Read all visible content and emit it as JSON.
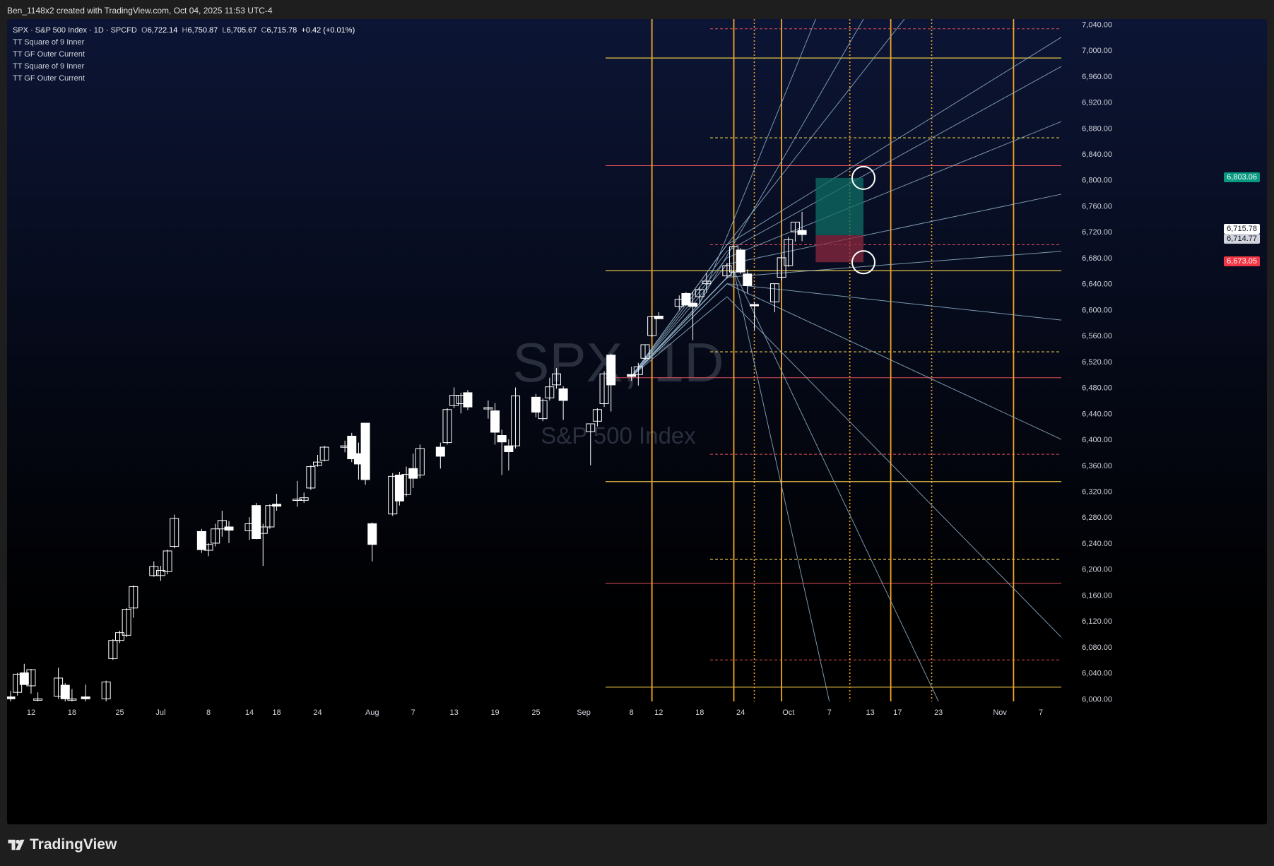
{
  "header": {
    "text": "Ben_1148x2 created with TradingView.com, Oct 04, 2025 11:53 UTC-4"
  },
  "brand": {
    "text": "TradingView",
    "icon": "tradingview-logo-icon"
  },
  "legend": {
    "symbol": "SPX · S&P 500 Index · 1D · SPCFD",
    "open_label": "O",
    "open": "6,722.14",
    "high_label": "H",
    "high": "6,750.87",
    "low_label": "L",
    "low": "6,705.67",
    "close_label": "C",
    "close": "6,715.78",
    "change": "+0.42 (+0.01%)",
    "indicators": [
      "TT Square of 9 Inner",
      "TT GF Outer Current",
      "TT Square of 9 Inner",
      "TT GF Outer Current"
    ]
  },
  "watermark": {
    "symbol": "SPX, 1D",
    "name": "S&P 500 Index"
  },
  "colors": {
    "background_top": "#0c1535",
    "background_bottom": "#000000",
    "candle": "#ffffff",
    "orange": "#f5a623",
    "yellow": "#e8c547",
    "red": "#e0505a",
    "fan": "#8fb0c8",
    "target_zone": "#0d6e66",
    "stop_zone": "#8b2840",
    "tag_green": "#089981",
    "tag_red": "#f23645"
  },
  "chart_data": {
    "type": "candlestick",
    "y_axis": {
      "range": [
        5996,
        7048
      ],
      "ticks": [
        6000,
        6040,
        6080,
        6120,
        6160,
        6200,
        6240,
        6280,
        6320,
        6360,
        6400,
        6440,
        6480,
        6520,
        6560,
        6600,
        6640,
        6680,
        6720,
        6760,
        6800,
        6840,
        6880,
        6920,
        6960,
        7000,
        7040
      ],
      "tick_labels": [
        "6,000.00",
        "6,040.00",
        "6,080.00",
        "6,120.00",
        "6,160.00",
        "6,200.00",
        "6,240.00",
        "6,280.00",
        "6,320.00",
        "6,360.00",
        "6,400.00",
        "6,440.00",
        "6,480.00",
        "6,520.00",
        "6,560.00",
        "6,600.00",
        "6,640.00",
        "6,680.00",
        "6,720.00",
        "6,760.00",
        "6,800.00",
        "6,840.00",
        "6,880.00",
        "6,920.00",
        "6,960.00",
        "7,000.00",
        "7,040.00"
      ]
    },
    "x_axis": {
      "start_date": "2025-06-09",
      "end_date": "2025-11-10",
      "labels": [
        {
          "date": "2025-06-12",
          "text": "12"
        },
        {
          "date": "2025-06-18",
          "text": "18"
        },
        {
          "date": "2025-06-25",
          "text": "25"
        },
        {
          "date": "2025-07-01",
          "text": "Jul"
        },
        {
          "date": "2025-07-08",
          "text": "8"
        },
        {
          "date": "2025-07-14",
          "text": "14"
        },
        {
          "date": "2025-07-18",
          "text": "18"
        },
        {
          "date": "2025-07-24",
          "text": "24"
        },
        {
          "date": "2025-08-01",
          "text": "Aug"
        },
        {
          "date": "2025-08-07",
          "text": "7"
        },
        {
          "date": "2025-08-13",
          "text": "13"
        },
        {
          "date": "2025-08-19",
          "text": "19"
        },
        {
          "date": "2025-08-25",
          "text": "25"
        },
        {
          "date": "2025-09-01",
          "text": "Sep"
        },
        {
          "date": "2025-09-08",
          "text": "8"
        },
        {
          "date": "2025-09-12",
          "text": "12"
        },
        {
          "date": "2025-09-18",
          "text": "18"
        },
        {
          "date": "2025-09-24",
          "text": "24"
        },
        {
          "date": "2025-10-01",
          "text": "Oct"
        },
        {
          "date": "2025-10-07",
          "text": "7"
        },
        {
          "date": "2025-10-13",
          "text": "13"
        },
        {
          "date": "2025-10-17",
          "text": "17"
        },
        {
          "date": "2025-10-23",
          "text": "23"
        },
        {
          "date": "2025-11-01",
          "text": "Nov"
        },
        {
          "date": "2025-11-07",
          "text": "7"
        }
      ]
    },
    "candles": [
      {
        "d": "2025-06-09",
        "o": 6003,
        "h": 6012,
        "l": 5996,
        "c": 6000
      },
      {
        "d": "2025-06-10",
        "o": 6010,
        "h": 6040,
        "l": 6005,
        "c": 6038
      },
      {
        "d": "2025-06-11",
        "o": 6040,
        "h": 6054,
        "l": 6022,
        "c": 6022
      },
      {
        "d": "2025-06-12",
        "o": 6020,
        "h": 6046,
        "l": 6008,
        "c": 6045
      },
      {
        "d": "2025-06-13",
        "o": 6000,
        "h": 6010,
        "l": 5996,
        "c": 6000
      },
      {
        "d": "2025-06-16",
        "o": 6004,
        "h": 6048,
        "l": 6000,
        "c": 6032
      },
      {
        "d": "2025-06-17",
        "o": 6021,
        "h": 6024,
        "l": 5996,
        "c": 6000
      },
      {
        "d": "2025-06-18",
        "o": 6000,
        "h": 6015,
        "l": 5996,
        "c": 6000
      },
      {
        "d": "2025-06-20",
        "o": 6003,
        "h": 6022,
        "l": 5996,
        "c": 6000
      },
      {
        "d": "2025-06-23",
        "o": 6000,
        "h": 6028,
        "l": 5996,
        "c": 6026
      },
      {
        "d": "2025-06-24",
        "o": 6062,
        "h": 6092,
        "l": 6060,
        "c": 6090
      },
      {
        "d": "2025-06-25",
        "o": 6090,
        "h": 6105,
        "l": 6086,
        "c": 6102
      },
      {
        "d": "2025-06-26",
        "o": 6098,
        "h": 6140,
        "l": 6095,
        "c": 6138
      },
      {
        "d": "2025-06-27",
        "o": 6140,
        "h": 6175,
        "l": 6125,
        "c": 6173
      },
      {
        "d": "2025-06-30",
        "o": 6190,
        "h": 6212,
        "l": 6188,
        "c": 6204
      },
      {
        "d": "2025-07-01",
        "o": 6190,
        "h": 6205,
        "l": 6182,
        "c": 6198
      },
      {
        "d": "2025-07-02",
        "o": 6196,
        "h": 6230,
        "l": 6192,
        "c": 6228
      },
      {
        "d": "2025-07-03",
        "o": 6235,
        "h": 6284,
        "l": 6232,
        "c": 6278
      },
      {
        "d": "2025-07-07",
        "o": 6258,
        "h": 6262,
        "l": 6225,
        "c": 6230
      },
      {
        "d": "2025-07-08",
        "o": 6229,
        "h": 6240,
        "l": 6220,
        "c": 6238
      },
      {
        "d": "2025-07-09",
        "o": 6240,
        "h": 6270,
        "l": 6235,
        "c": 6262
      },
      {
        "d": "2025-07-10",
        "o": 6262,
        "h": 6290,
        "l": 6250,
        "c": 6275
      },
      {
        "d": "2025-07-11",
        "o": 6265,
        "h": 6274,
        "l": 6240,
        "c": 6260
      },
      {
        "d": "2025-07-14",
        "o": 6259,
        "h": 6280,
        "l": 6245,
        "c": 6270
      },
      {
        "d": "2025-07-15",
        "o": 6298,
        "h": 6302,
        "l": 6246,
        "c": 6247
      },
      {
        "d": "2025-07-16",
        "o": 6255,
        "h": 6270,
        "l": 6205,
        "c": 6265
      },
      {
        "d": "2025-07-17",
        "o": 6265,
        "h": 6300,
        "l": 6262,
        "c": 6298
      },
      {
        "d": "2025-07-18",
        "o": 6300,
        "h": 6316,
        "l": 6290,
        "c": 6297
      },
      {
        "d": "2025-07-21",
        "o": 6308,
        "h": 6336,
        "l": 6296,
        "c": 6308
      },
      {
        "d": "2025-07-22",
        "o": 6306,
        "h": 6318,
        "l": 6302,
        "c": 6310
      },
      {
        "d": "2025-07-23",
        "o": 6325,
        "h": 6360,
        "l": 6322,
        "c": 6358
      },
      {
        "d": "2025-07-24",
        "o": 6360,
        "h": 6376,
        "l": 6358,
        "c": 6365
      },
      {
        "d": "2025-07-25",
        "o": 6368,
        "h": 6390,
        "l": 6366,
        "c": 6388
      },
      {
        "d": "2025-07-28",
        "o": 6388,
        "h": 6398,
        "l": 6380,
        "c": 6390
      },
      {
        "d": "2025-07-29",
        "o": 6405,
        "h": 6410,
        "l": 6365,
        "c": 6370
      },
      {
        "d": "2025-07-30",
        "o": 6378,
        "h": 6395,
        "l": 6338,
        "c": 6362
      },
      {
        "d": "2025-07-31",
        "o": 6425,
        "h": 6425,
        "l": 6330,
        "c": 6338
      },
      {
        "d": "2025-08-01",
        "o": 6270,
        "h": 6272,
        "l": 6212,
        "c": 6238
      },
      {
        "d": "2025-08-04",
        "o": 6285,
        "h": 6348,
        "l": 6282,
        "c": 6343
      },
      {
        "d": "2025-08-05",
        "o": 6345,
        "h": 6350,
        "l": 6298,
        "c": 6305
      },
      {
        "d": "2025-08-06",
        "o": 6315,
        "h": 6358,
        "l": 6312,
        "c": 6346
      },
      {
        "d": "2025-08-07",
        "o": 6355,
        "h": 6378,
        "l": 6325,
        "c": 6340
      },
      {
        "d": "2025-08-08",
        "o": 6345,
        "h": 6392,
        "l": 6340,
        "c": 6386
      },
      {
        "d": "2025-08-11",
        "o": 6388,
        "h": 6395,
        "l": 6355,
        "c": 6374
      },
      {
        "d": "2025-08-12",
        "o": 6395,
        "h": 6448,
        "l": 6392,
        "c": 6446
      },
      {
        "d": "2025-08-13",
        "o": 6452,
        "h": 6480,
        "l": 6448,
        "c": 6468
      },
      {
        "d": "2025-08-14",
        "o": 6455,
        "h": 6472,
        "l": 6440,
        "c": 6468
      },
      {
        "d": "2025-08-15",
        "o": 6472,
        "h": 6476,
        "l": 6445,
        "c": 6450
      },
      {
        "d": "2025-08-18",
        "o": 6448,
        "h": 6460,
        "l": 6432,
        "c": 6449
      },
      {
        "d": "2025-08-19",
        "o": 6444,
        "h": 6456,
        "l": 6392,
        "c": 6411
      },
      {
        "d": "2025-08-20",
        "o": 6406,
        "h": 6415,
        "l": 6345,
        "c": 6396
      },
      {
        "d": "2025-08-21",
        "o": 6390,
        "h": 6400,
        "l": 6352,
        "c": 6381
      },
      {
        "d": "2025-08-22",
        "o": 6390,
        "h": 6480,
        "l": 6386,
        "c": 6467
      },
      {
        "d": "2025-08-25",
        "o": 6465,
        "h": 6470,
        "l": 6434,
        "c": 6442
      },
      {
        "d": "2025-08-26",
        "o": 6432,
        "h": 6463,
        "l": 6428,
        "c": 6460
      },
      {
        "d": "2025-08-27",
        "o": 6464,
        "h": 6495,
        "l": 6460,
        "c": 6481
      },
      {
        "d": "2025-08-28",
        "o": 6484,
        "h": 6510,
        "l": 6478,
        "c": 6501
      },
      {
        "d": "2025-08-29",
        "o": 6478,
        "h": 6482,
        "l": 6430,
        "c": 6460
      },
      {
        "d": "2025-09-02",
        "o": 6412,
        "h": 6423,
        "l": 6360,
        "c": 6424
      },
      {
        "d": "2025-09-03",
        "o": 6428,
        "h": 6448,
        "l": 6420,
        "c": 6446
      },
      {
        "d": "2025-09-04",
        "o": 6455,
        "h": 6505,
        "l": 6450,
        "c": 6501
      },
      {
        "d": "2025-09-05",
        "o": 6530,
        "h": 6532,
        "l": 6443,
        "c": 6484
      },
      {
        "d": "2025-09-08",
        "o": 6500,
        "h": 6512,
        "l": 6490,
        "c": 6497
      },
      {
        "d": "2025-09-09",
        "o": 6500,
        "h": 6518,
        "l": 6483,
        "c": 6512
      },
      {
        "d": "2025-09-10",
        "o": 6525,
        "h": 6546,
        "l": 6522,
        "c": 6546
      },
      {
        "d": "2025-09-11",
        "o": 6560,
        "h": 6590,
        "l": 6558,
        "c": 6589
      },
      {
        "d": "2025-09-12",
        "o": 6590,
        "h": 6596,
        "l": 6586,
        "c": 6586
      },
      {
        "d": "2025-09-15",
        "o": 6605,
        "h": 6622,
        "l": 6600,
        "c": 6616
      },
      {
        "d": "2025-09-16",
        "o": 6625,
        "h": 6627,
        "l": 6608,
        "c": 6607
      },
      {
        "d": "2025-09-17",
        "o": 6610,
        "h": 6628,
        "l": 6553,
        "c": 6605
      },
      {
        "d": "2025-09-18",
        "o": 6620,
        "h": 6635,
        "l": 6608,
        "c": 6631
      },
      {
        "d": "2025-09-19",
        "o": 6640,
        "h": 6656,
        "l": 6626,
        "c": 6644
      },
      {
        "d": "2025-09-22",
        "o": 6652,
        "h": 6672,
        "l": 6648,
        "c": 6668
      },
      {
        "d": "2025-09-23",
        "o": 6658,
        "h": 6695,
        "l": 6650,
        "c": 6697
      },
      {
        "d": "2025-09-24",
        "o": 6692,
        "h": 6695,
        "l": 6655,
        "c": 6658
      },
      {
        "d": "2025-09-25",
        "o": 6655,
        "h": 6662,
        "l": 6626,
        "c": 6637
      },
      {
        "d": "2025-09-26",
        "o": 6608,
        "h": 6612,
        "l": 6569,
        "c": 6607
      },
      {
        "d": "2025-09-29",
        "o": 6612,
        "h": 6640,
        "l": 6596,
        "c": 6640
      },
      {
        "d": "2025-09-30",
        "o": 6650,
        "h": 6686,
        "l": 6645,
        "c": 6680
      },
      {
        "d": "2025-10-01",
        "o": 6668,
        "h": 6712,
        "l": 6666,
        "c": 6708
      },
      {
        "d": "2025-10-02",
        "o": 6720,
        "h": 6734,
        "l": 6705,
        "c": 6735
      },
      {
        "d": "2025-10-03",
        "o": 6722.14,
        "h": 6750.87,
        "l": 6705.67,
        "c": 6715.78
      }
    ],
    "gann_levels": {
      "orange_vertical_solid": [
        "2025-09-11",
        "2025-09-23",
        "2025-09-30",
        "2025-10-16",
        "2025-11-03"
      ],
      "orange_vertical_dotted": [
        "2025-09-26",
        "2025-10-10",
        "2025-10-22"
      ],
      "yellow_horizontal_solid": [
        6988,
        6660,
        6335,
        6018
      ],
      "yellow_horizontal_dashed": [
        6865,
        6535,
        6215
      ],
      "red_horizontal_solid": [
        6822,
        6495,
        6178
      ],
      "red_horizontal_dashed": [
        7033,
        6700,
        6377,
        6060
      ]
    },
    "fan_lines": {
      "origin": {
        "date": "2025-09-08",
        "value": 6497
      },
      "rising": [
        {
          "pivot": "2025-09-22",
          "pivot_value": 6700,
          "end": "2025-10-18",
          "end_value": 7150
        },
        {
          "pivot": "2025-09-22",
          "pivot_value": 6700,
          "end": "2025-11-10",
          "end_value": 7020
        },
        {
          "pivot": "2025-09-22",
          "pivot_value": 6690,
          "end": "2025-11-10",
          "end_value": 6975
        },
        {
          "pivot": "2025-09-22",
          "pivot_value": 6680,
          "end": "2025-11-10",
          "end_value": 6890
        },
        {
          "pivot": "2025-09-22",
          "pivot_value": 6670,
          "end": "2025-11-10",
          "end_value": 6778
        },
        {
          "pivot": "2025-09-22",
          "pivot_value": 6650,
          "end": "2025-11-10",
          "end_value": 6690
        },
        {
          "pivot": "2025-09-22",
          "pivot_value": 6640,
          "end": "2025-11-10",
          "end_value": 6584
        },
        {
          "pivot": "2025-09-18",
          "pivot_value": 6610,
          "end": "2025-10-05",
          "end_value": 7200
        },
        {
          "pivot": "2025-09-18",
          "pivot_value": 6610,
          "end": "2025-10-12",
          "end_value": 7150
        }
      ],
      "falling": [
        {
          "pivot": "2025-09-22",
          "pivot_value": 6640,
          "end": "2025-11-10",
          "end_value": 6400
        },
        {
          "pivot": "2025-09-22",
          "pivot_value": 6620,
          "end": "2025-11-10",
          "end_value": 6095
        },
        {
          "pivot": "2025-09-23",
          "pivot_value": 6660,
          "end": "2025-10-23",
          "end_value": 5996
        },
        {
          "pivot": "2025-09-23",
          "pivot_value": 6660,
          "end": "2025-10-07",
          "end_value": 5996
        }
      ]
    },
    "position": {
      "entry": 6714.77,
      "target": 6803.06,
      "stop": 6673.05,
      "start_date": "2025-10-05",
      "end_date": "2025-10-12"
    },
    "price_tags": [
      {
        "value": 6803.06,
        "text": "6,803.06",
        "style": "green"
      },
      {
        "value": 6715.78,
        "text": "6,715.78",
        "style": "white"
      },
      {
        "value": 6714.77,
        "text": "6,714.77",
        "style": "grey"
      },
      {
        "value": 6673.05,
        "text": "6,673.05",
        "style": "red"
      }
    ]
  }
}
